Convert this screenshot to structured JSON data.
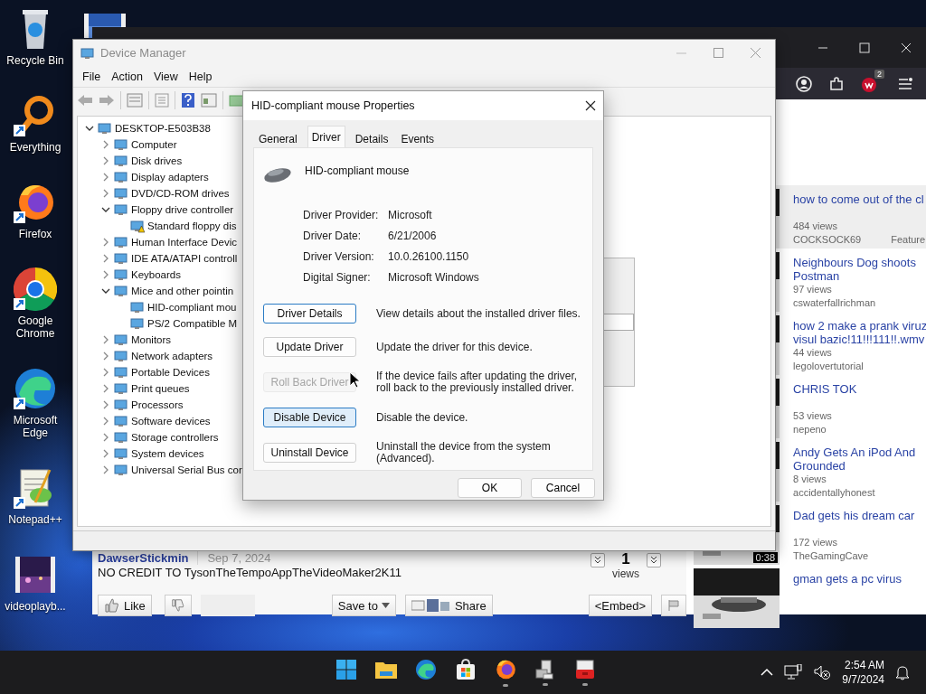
{
  "desktop_icons": [
    {
      "label": "Recycle Bin",
      "kind": "bin",
      "shortcut": false
    },
    {
      "label": "Everything",
      "kind": "magnifier",
      "shortcut": true
    },
    {
      "label": "Firefox",
      "kind": "fox",
      "shortcut": true
    },
    {
      "label": "Google Chrome",
      "kind": "ring",
      "shortcut": true
    },
    {
      "label": "Microsoft Edge",
      "kind": "wave",
      "shortcut": true
    },
    {
      "label": "Notepad++",
      "kind": "notepad",
      "shortcut": true
    },
    {
      "label": "videoplayb...",
      "kind": "video",
      "shortcut": false
    }
  ],
  "browser": {
    "toolbar_badge": "2",
    "related_videos": [
      {
        "title": "how to come out of the cl",
        "views": "484 views",
        "author": "COCKSOCK69",
        "extra": "Feature",
        "selected": true
      },
      {
        "title": "Neighbours Dog shoots Postman",
        "views": "97 views",
        "author": "cswaterfallrichman",
        "selected": false
      },
      {
        "title": "how 2 make a prank viruz",
        "title_2": "visul bazic!11!!!111!!.wmv",
        "views": "44 views",
        "author": "legolovertutorial",
        "selected": false
      },
      {
        "title": "CHRIS TOK",
        "views": "53 views",
        "author": "nepeno",
        "selected": false
      },
      {
        "title": "Andy Gets An iPod And",
        "title_2": "Grounded",
        "views": "8 views",
        "author": "accidentallyhonest",
        "selected": false
      },
      {
        "title": "Dad gets his dream car",
        "views": "172 views",
        "author": "TheGamingCave",
        "duration": "0:38",
        "selected": false
      },
      {
        "title": "gman gets a pc virus",
        "selected": false
      }
    ],
    "video_info": {
      "author": "DawserStickmin",
      "date": "Sep 7, 2024",
      "description": "NO CREDIT TO TysonTheTempoAppTheVideoMaker2K11",
      "view_count": "1",
      "views_label": "views",
      "actions": [
        {
          "label": "Like",
          "kind": "like"
        },
        {
          "kind": "dislike"
        },
        {
          "kind": "blank"
        },
        {
          "label": "Save to",
          "kind": "save"
        },
        {
          "label": "Share",
          "kind": "share"
        },
        {
          "label": "<Embed>",
          "kind": "embed"
        },
        {
          "kind": "flag"
        }
      ]
    }
  },
  "device_manager": {
    "title": "Device Manager",
    "menu": [
      "File",
      "Action",
      "View",
      "Help"
    ],
    "tree": {
      "label": "DESKTOP-E503B38",
      "expanded": true,
      "children": [
        {
          "label": "Computer",
          "expanded": false
        },
        {
          "label": "Disk drives",
          "expanded": false
        },
        {
          "label": "Display adapters",
          "expanded": false
        },
        {
          "label": "DVD/CD-ROM drives",
          "expanded": false
        },
        {
          "label": "Floppy drive controller",
          "expanded": true,
          "children": [
            {
              "label": "Standard floppy dis",
              "warning": true
            }
          ]
        },
        {
          "label": "Human Interface Devic",
          "expanded": false
        },
        {
          "label": "IDE ATA/ATAPI controll",
          "expanded": false
        },
        {
          "label": "Keyboards",
          "expanded": false
        },
        {
          "label": "Mice and other pointin",
          "expanded": true,
          "children": [
            {
              "label": "HID-compliant mou",
              "warning": false
            },
            {
              "label": "PS/2 Compatible M",
              "warning": false
            }
          ]
        },
        {
          "label": "Monitors",
          "expanded": false
        },
        {
          "label": "Network adapters",
          "expanded": false
        },
        {
          "label": "Portable Devices",
          "expanded": false
        },
        {
          "label": "Print queues",
          "expanded": false
        },
        {
          "label": "Processors",
          "expanded": false
        },
        {
          "label": "Software devices",
          "expanded": false
        },
        {
          "label": "Storage controllers",
          "expanded": false
        },
        {
          "label": "System devices",
          "expanded": false
        },
        {
          "label": "Universal Serial Bus cor",
          "expanded": false
        }
      ]
    }
  },
  "dialog": {
    "title": "HID-compliant mouse Properties",
    "tabs": [
      {
        "label": "General",
        "selected": false
      },
      {
        "label": "Driver",
        "selected": true
      },
      {
        "label": "Details",
        "selected": false
      },
      {
        "label": "Events",
        "selected": false
      }
    ],
    "device_name": "HID-compliant mouse",
    "info": [
      {
        "label": "Driver Provider:",
        "value": "Microsoft"
      },
      {
        "label": "Driver Date:",
        "value": "6/21/2006"
      },
      {
        "label": "Driver Version:",
        "value": "10.0.26100.1150"
      },
      {
        "label": "Digital Signer:",
        "value": "Microsoft Windows"
      }
    ],
    "actions": [
      {
        "button": "Driver Details",
        "description": "View details about the installed driver files.",
        "disabled": false,
        "focused": true,
        "hovered": false
      },
      {
        "button": "Update Driver",
        "description": "Update the driver for this device.",
        "disabled": false,
        "focused": false,
        "hovered": false
      },
      {
        "button": "Roll Back Driver",
        "description": "If the device fails after updating the driver, roll back to the previously installed driver.",
        "disabled": true,
        "focused": false,
        "hovered": false
      },
      {
        "button": "Disable Device",
        "description": "Disable the device.",
        "disabled": false,
        "focused": false,
        "hovered": true
      },
      {
        "button": "Uninstall Device",
        "description": "Uninstall the device from the system (Advanced).",
        "disabled": false,
        "focused": false,
        "hovered": false
      }
    ],
    "buttons": [
      "OK",
      "Cancel"
    ]
  },
  "taskbar": {
    "apps": [
      {
        "kind": "start",
        "running": false
      },
      {
        "kind": "folder",
        "running": false
      },
      {
        "kind": "wave",
        "running": false
      },
      {
        "kind": "store",
        "running": false
      },
      {
        "kind": "fox",
        "running": true
      },
      {
        "kind": "device",
        "running": true
      },
      {
        "kind": "toolbox",
        "running": true
      }
    ],
    "time": "2:54 AM",
    "date": "9/7/2024"
  }
}
